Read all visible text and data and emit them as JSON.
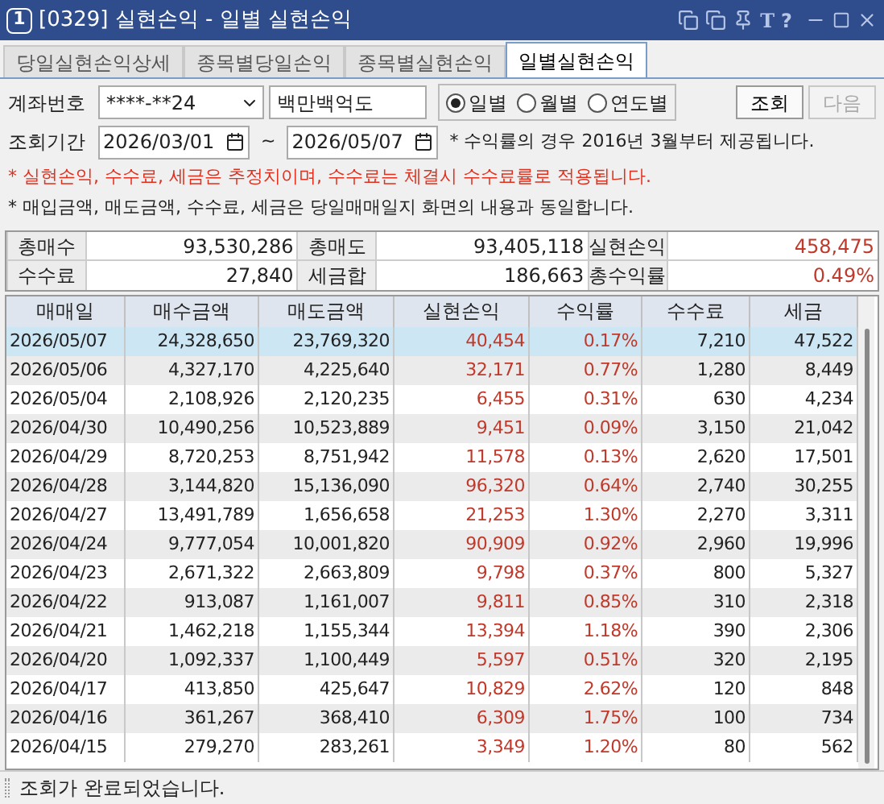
{
  "window": {
    "number": "1",
    "title": "[0329] 실현손익 - 일별 실현손익",
    "tool_glyph": "T",
    "help_glyph": "?"
  },
  "tabs": [
    {
      "label": "당일실현손익상세",
      "selected": false
    },
    {
      "label": "종목별당일손익",
      "selected": false
    },
    {
      "label": "종목별실현손익",
      "selected": false
    },
    {
      "label": "일별실현손익",
      "selected": true
    }
  ],
  "account": {
    "label": "계좌번호",
    "value": "****-**24",
    "name": "백만백억도"
  },
  "period_options": [
    {
      "label": "일별",
      "selected": true
    },
    {
      "label": "월별",
      "selected": false
    },
    {
      "label": "연도별",
      "selected": false
    }
  ],
  "buttons": [
    {
      "label": "조회",
      "disabled": false
    },
    {
      "label": "다음",
      "disabled": true
    }
  ],
  "range": {
    "label": "조회기간",
    "from": "2026/03/01",
    "separator": "~",
    "to": "2026/05/07",
    "note": "* 수익률의 경우 2016년 3월부터 제공됩니다."
  },
  "notes": [
    {
      "text": "* 실현손익, 수수료, 세금은 추정치이며, 수수료는 체결시 수수료률로 적용됩니다.",
      "color": "#e0301e"
    },
    {
      "text": "* 매입금액, 매도금액, 수수료, 세금은 당일매매일지 화면의 내용과 동일합니다.",
      "color": "#222222"
    }
  ],
  "summary": [
    [
      {
        "label": "총매수",
        "value": "93,530,286",
        "profit": false
      },
      {
        "label": "총매도",
        "value": "93,405,118",
        "profit": false
      },
      {
        "label": "실현손익",
        "value": "458,475",
        "profit": true
      }
    ],
    [
      {
        "label": "수수료",
        "value": "27,840",
        "profit": false
      },
      {
        "label": "세금합",
        "value": "186,663",
        "profit": false
      },
      {
        "label": "총수익률",
        "value": "0.49%",
        "profit": true
      }
    ]
  ],
  "table": {
    "columns": [
      "매매일",
      "매수금액",
      "매도금액",
      "실현손익",
      "수익률",
      "수수료",
      "세금"
    ],
    "rows": [
      {
        "selected": true,
        "cells": [
          "2026/05/07",
          "24,328,650",
          "23,769,320",
          "40,454",
          "0.17%",
          "7,210",
          "47,522"
        ]
      },
      {
        "selected": false,
        "cells": [
          "2026/05/06",
          "4,327,170",
          "4,225,640",
          "32,171",
          "0.77%",
          "1,280",
          "8,449"
        ]
      },
      {
        "selected": false,
        "cells": [
          "2026/05/04",
          "2,108,926",
          "2,120,235",
          "6,455",
          "0.31%",
          "630",
          "4,234"
        ]
      },
      {
        "selected": false,
        "cells": [
          "2026/04/30",
          "10,490,256",
          "10,523,889",
          "9,451",
          "0.09%",
          "3,150",
          "21,042"
        ]
      },
      {
        "selected": false,
        "cells": [
          "2026/04/29",
          "8,720,253",
          "8,751,942",
          "11,578",
          "0.13%",
          "2,620",
          "17,501"
        ]
      },
      {
        "selected": false,
        "cells": [
          "2026/04/28",
          "3,144,820",
          "15,136,090",
          "96,320",
          "0.64%",
          "2,740",
          "30,255"
        ]
      },
      {
        "selected": false,
        "cells": [
          "2026/04/27",
          "13,491,789",
          "1,656,658",
          "21,253",
          "1.30%",
          "2,270",
          "3,311"
        ]
      },
      {
        "selected": false,
        "cells": [
          "2026/04/24",
          "9,777,054",
          "10,001,820",
          "90,909",
          "0.92%",
          "2,960",
          "19,996"
        ]
      },
      {
        "selected": false,
        "cells": [
          "2026/04/23",
          "2,671,322",
          "2,663,809",
          "9,798",
          "0.37%",
          "800",
          "5,327"
        ]
      },
      {
        "selected": false,
        "cells": [
          "2026/04/22",
          "913,087",
          "1,161,007",
          "9,811",
          "0.85%",
          "310",
          "2,318"
        ]
      },
      {
        "selected": false,
        "cells": [
          "2026/04/21",
          "1,462,218",
          "1,155,344",
          "13,394",
          "1.18%",
          "390",
          "2,306"
        ]
      },
      {
        "selected": false,
        "cells": [
          "2026/04/20",
          "1,092,337",
          "1,100,449",
          "5,597",
          "0.51%",
          "320",
          "2,195"
        ]
      },
      {
        "selected": false,
        "cells": [
          "2026/04/17",
          "413,850",
          "425,647",
          "10,829",
          "2.62%",
          "120",
          "848"
        ]
      },
      {
        "selected": false,
        "cells": [
          "2026/04/16",
          "361,267",
          "368,410",
          "6,309",
          "1.75%",
          "100",
          "734"
        ]
      },
      {
        "selected": false,
        "cells": [
          "2026/04/15",
          "279,270",
          "283,261",
          "3,349",
          "1.20%",
          "80",
          "562"
        ]
      }
    ]
  },
  "status_bar": {
    "message": "조회가 완료되었습니다."
  }
}
